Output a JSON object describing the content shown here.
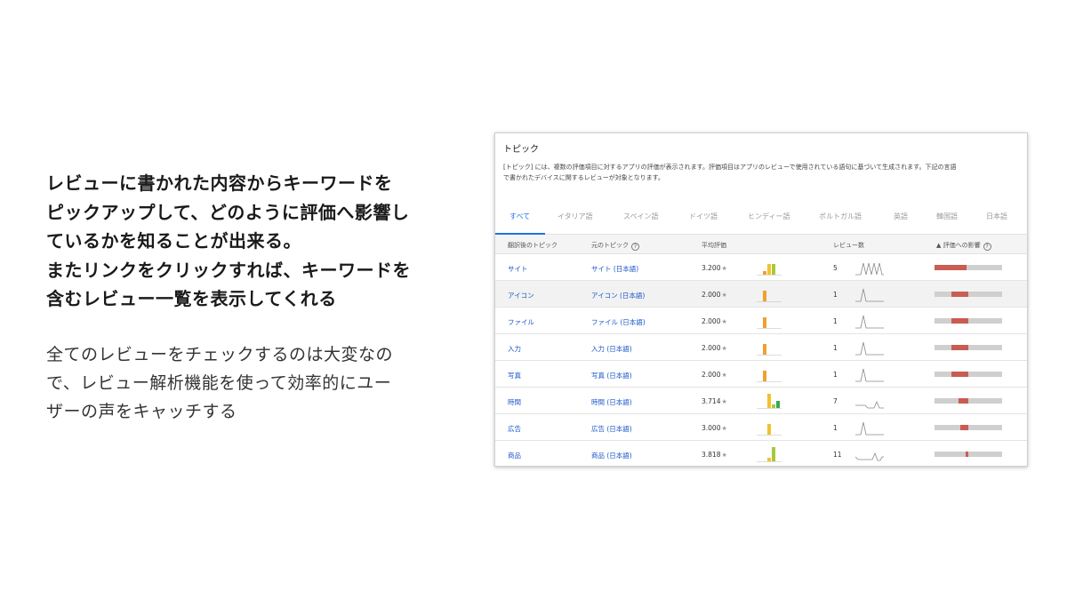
{
  "left": {
    "headline_lines": [
      "レビューに書かれた内容からキーワードを",
      "ピックアップして、どのように評価へ影響し",
      "ているかを知ることが出来る。",
      "またリンクをクリックすれば、キーワードを",
      "含むレビュー一覧を表示してくれる"
    ],
    "sub_lines": [
      "全てのレビューをチェックするのは大変なの",
      "で、レビュー解析機能を使って効率的にユー",
      "ザーの声をキャッチする"
    ]
  },
  "panel": {
    "title": "トピック",
    "desc_lines": [
      "[トピック] には、複数の評価項目に対するアプリの評価が表示されます。評価項目はアプリのレビューで使用されている語句に基づいて生成されます。下記の言語",
      "で書かれたデバイスに関するレビューが対象となります。"
    ],
    "tabs": [
      "すべて",
      "イタリア語",
      "スペイン語",
      "ドイツ語",
      "ヒンディー語",
      "ポルトガル語",
      "英語",
      "韓国語",
      "日本語"
    ],
    "active_tab": "すべて",
    "headers": {
      "translated": "翻訳後のトピック",
      "original": "元のトピック",
      "avg": "平均評価",
      "reviews": "レビュー数",
      "impact": "▲ 評価への影響"
    },
    "help_glyph": "?",
    "star_glyph": "★",
    "rows": [
      {
        "translated": "サイト",
        "original": "サイト (日本語)",
        "avg": "3.200",
        "count": "5",
        "dist": [
          0,
          1,
          3,
          3,
          0
        ],
        "spark": "multi",
        "impact": 0.48
      },
      {
        "translated": "アイコン",
        "original": "アイコン (日本語)",
        "avg": "2.000",
        "count": "1",
        "dist": [
          0,
          3,
          0,
          0,
          0
        ],
        "spark": "single",
        "impact": 0.25
      },
      {
        "translated": "ファイル",
        "original": "ファイル (日本語)",
        "avg": "2.000",
        "count": "1",
        "dist": [
          0,
          3,
          0,
          0,
          0
        ],
        "spark": "single",
        "impact": 0.25
      },
      {
        "translated": "入力",
        "original": "入力 (日本語)",
        "avg": "2.000",
        "count": "1",
        "dist": [
          0,
          3,
          0,
          0,
          0
        ],
        "spark": "single",
        "impact": 0.25
      },
      {
        "translated": "写真",
        "original": "写真 (日本語)",
        "avg": "2.000",
        "count": "1",
        "dist": [
          0,
          3,
          0,
          0,
          0
        ],
        "spark": "single",
        "impact": 0.25
      },
      {
        "translated": "時間",
        "original": "時間 (日本語)",
        "avg": "3.714",
        "count": "7",
        "dist": [
          0,
          0,
          4,
          1,
          2
        ],
        "spark": "two",
        "impact": 0.14
      },
      {
        "translated": "広告",
        "original": "広告 (日本語)",
        "avg": "3.000",
        "count": "1",
        "dist": [
          0,
          0,
          3,
          0,
          0
        ],
        "spark": "single",
        "impact": 0.12
      },
      {
        "translated": "商品",
        "original": "商品 (日本語)",
        "avg": "3.818",
        "count": "11",
        "dist": [
          0,
          0,
          1,
          4,
          0
        ],
        "spark": "wide",
        "impact": 0.04
      }
    ],
    "colors": {
      "dist": [
        "#e8712a",
        "#f0a030",
        "#f2c12e",
        "#a8c83a",
        "#34a853"
      ],
      "impact_neg": "#c95c53",
      "link": "#1a56c8",
      "active_tab": "#1a73e8"
    }
  }
}
